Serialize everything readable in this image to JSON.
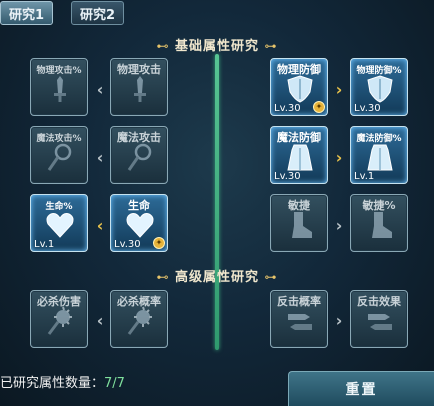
{
  "tabs": [
    {
      "label": "研究1",
      "active": true
    },
    {
      "label": "研究2",
      "active": false
    }
  ],
  "sections": {
    "basic_title": "基础属性研究",
    "advanced_title": "高级属性研究",
    "ornament_left": "⊷",
    "ornament_right": "⊶"
  },
  "skills": {
    "phys_atk_pct": {
      "name": "物理攻击%",
      "level": ""
    },
    "phys_atk": {
      "name": "物理攻击",
      "level": ""
    },
    "phys_def": {
      "name": "物理防御",
      "level": "Lv.30"
    },
    "phys_def_pct": {
      "name": "物理防御%",
      "level": "Lv.30"
    },
    "mag_atk_pct": {
      "name": "魔法攻击%",
      "level": ""
    },
    "mag_atk": {
      "name": "魔法攻击",
      "level": ""
    },
    "mag_def": {
      "name": "魔法防御",
      "level": "Lv.30"
    },
    "mag_def_pct": {
      "name": "魔法防御%",
      "level": "Lv.1"
    },
    "hp_pct": {
      "name": "生命%",
      "level": "Lv.1"
    },
    "hp": {
      "name": "生命",
      "level": "Lv.30"
    },
    "agility": {
      "name": "敏捷",
      "level": ""
    },
    "agility_pct": {
      "name": "敏捷%",
      "level": ""
    },
    "crit_dmg": {
      "name": "必杀伤害",
      "level": ""
    },
    "crit_rate": {
      "name": "必杀概率",
      "level": ""
    },
    "counter_rate": {
      "name": "反击概率",
      "level": ""
    },
    "counter_effect": {
      "name": "反击效果",
      "level": ""
    }
  },
  "arrows": {
    "left": "‹",
    "right": "›"
  },
  "footer": {
    "count_label": "已研究属性数量：",
    "count_value": "7/7",
    "reset_label": "重置"
  },
  "colors": {
    "accent_gold": "#e8c24b",
    "divider_green": "#3aa37a",
    "active_tile": "#2d6b98",
    "count_green": "#7fe09d"
  },
  "icons": {
    "phys_atk": "sword-icon",
    "phys_def": "shield-icon",
    "mag_atk": "staff-icon",
    "mag_def": "robe-icon",
    "hp": "heart-icon",
    "agility": "boot-icon",
    "crit": "spiked-mace-icon",
    "counter": "crossed-swords-icon",
    "level_badge": "thumb-badge-icon"
  }
}
